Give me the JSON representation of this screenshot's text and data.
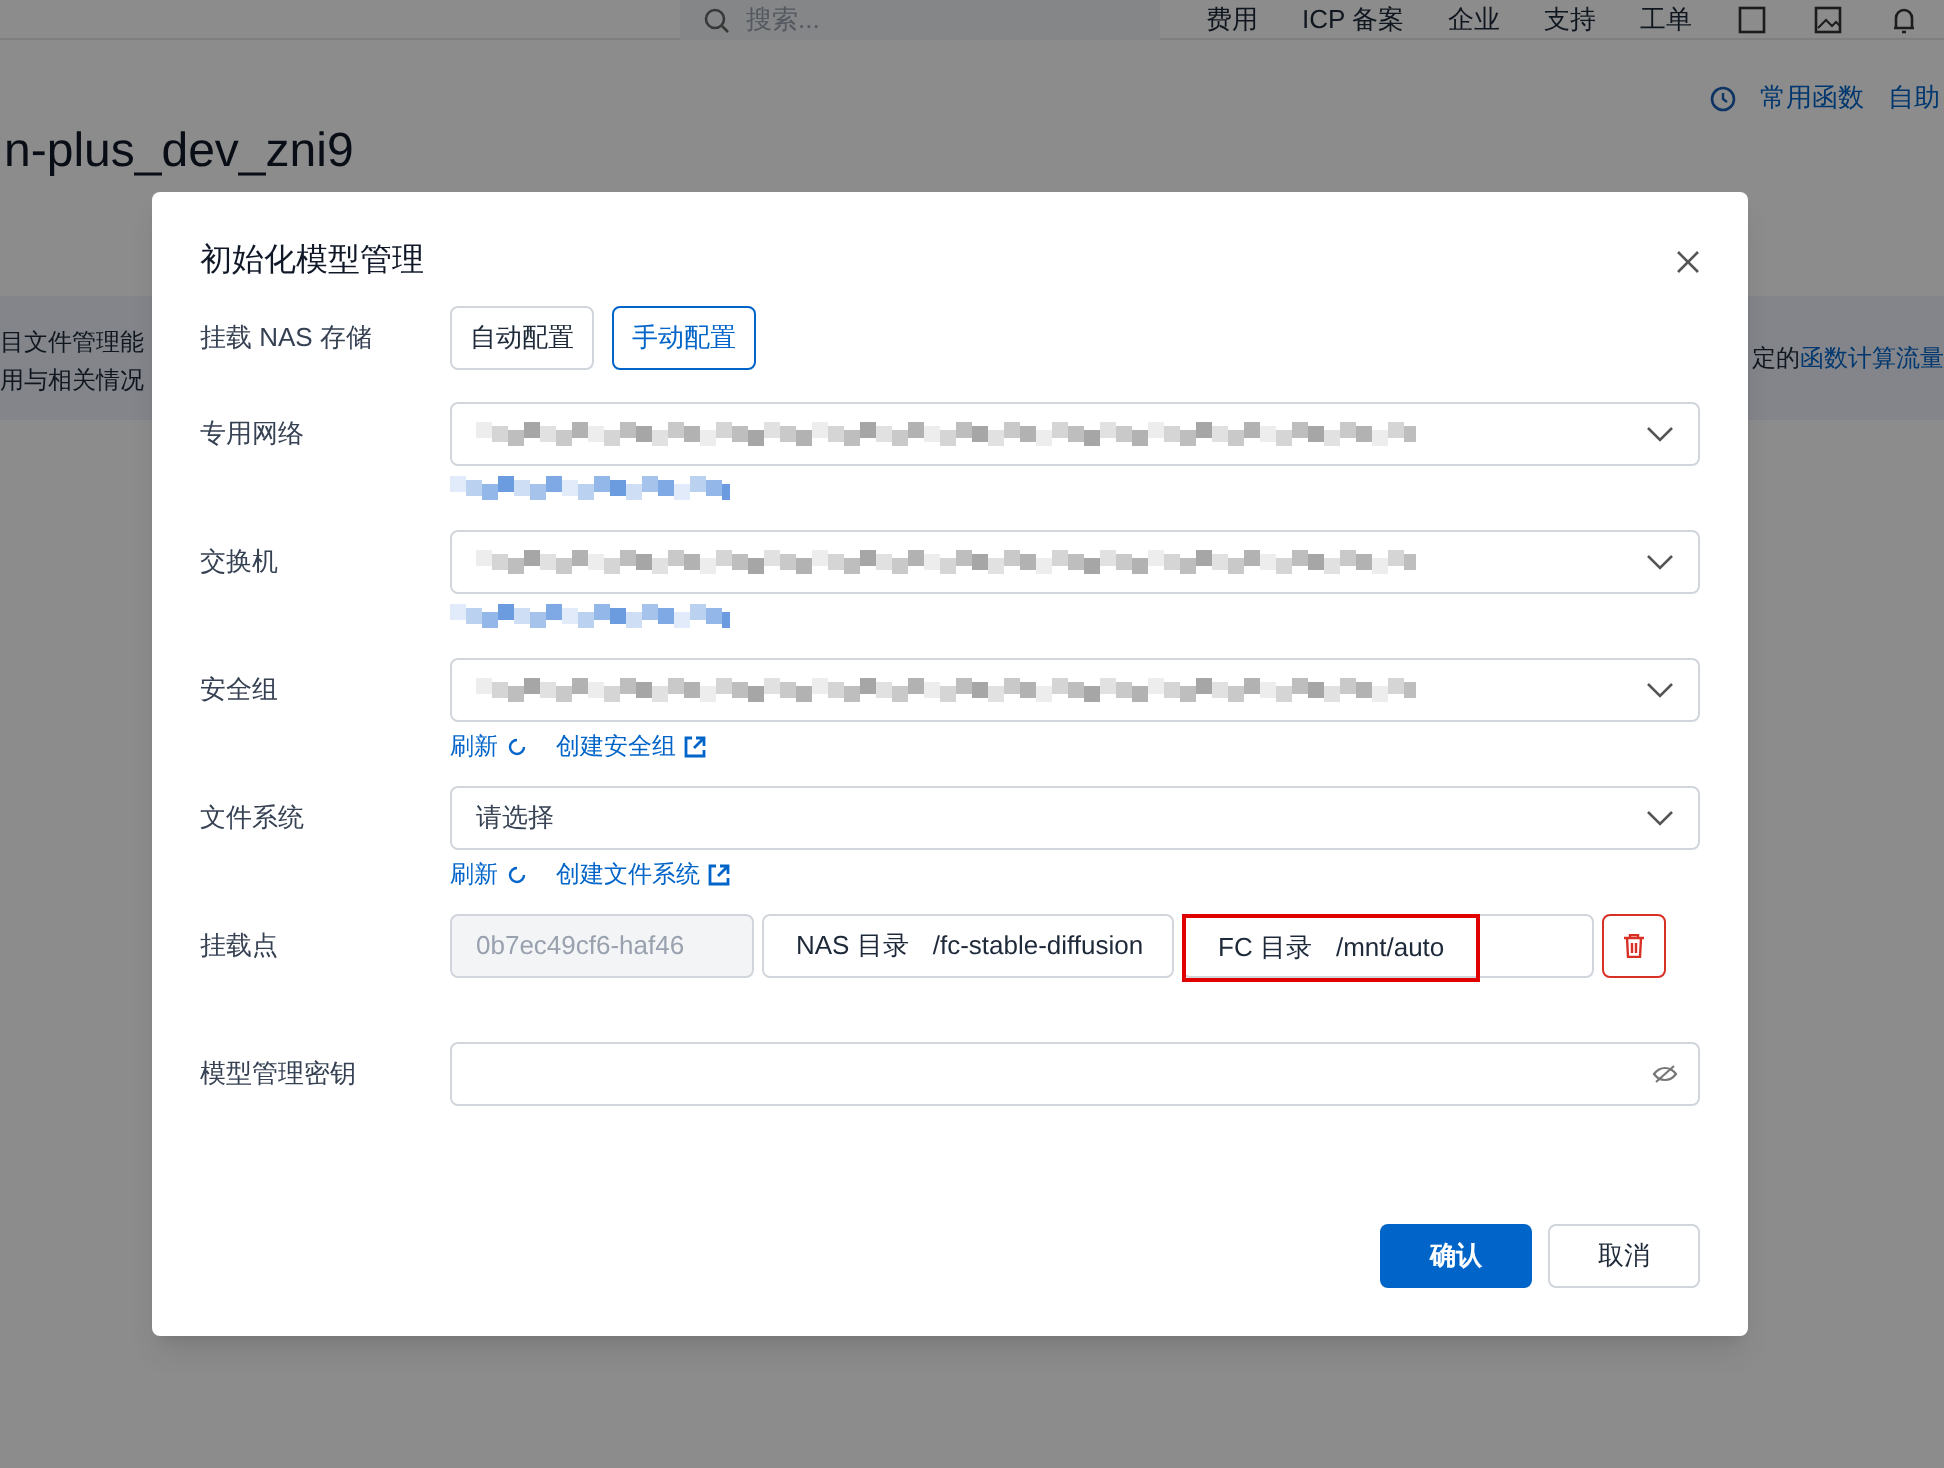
{
  "top_nav": {
    "search_placeholder": "搜索...",
    "items": [
      "费用",
      "ICP 备案",
      "企业",
      "支持",
      "工单"
    ]
  },
  "header_links": [
    "常用函数",
    "自助"
  ],
  "page_title": "n-plus_dev_zni9",
  "banner": {
    "line_1": "目文件管理能",
    "line_2": "用与相关情况",
    "right_text": "定的",
    "right_link": "函数计算流量"
  },
  "dialog": {
    "title": "初始化模型管理",
    "storage": {
      "label": "挂载 NAS 存储",
      "options": [
        {
          "label": "自动配置",
          "selected": false
        },
        {
          "label": "手动配置",
          "selected": true
        }
      ]
    },
    "fields": [
      {
        "kind": "select",
        "label": "专用网络",
        "redacted": true
      },
      {
        "kind": "select",
        "label": "交换机",
        "redacted": true
      },
      {
        "kind": "select",
        "label": "安全组",
        "redacted": true,
        "links": [
          "刷新",
          "创建安全组"
        ]
      },
      {
        "kind": "select",
        "label": "文件系统",
        "placeholder": "请选择",
        "links": [
          "刷新",
          "创建文件系统"
        ]
      },
      {
        "kind": "mount",
        "label": "挂载点",
        "mount_target": "0b7ec49cf6-haf46",
        "nas_dir_label": "NAS 目录",
        "nas_dir": "/fc-stable-diffusion",
        "fc_dir_label": "FC 目录",
        "fc_dir": "/mnt/auto",
        "highlighted": true
      },
      {
        "kind": "password",
        "label": "模型管理密钥"
      }
    ],
    "buttons": [
      {
        "label": "确认",
        "primary": true
      },
      {
        "label": "取消",
        "primary": false
      }
    ]
  }
}
